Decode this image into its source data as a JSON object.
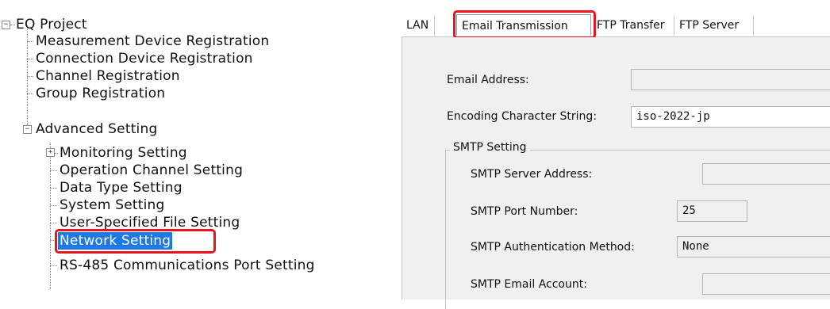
{
  "tree": {
    "root": "EQ Project",
    "items": [
      "Measurement Device Registration",
      "Connection Device Registration",
      "Channel Registration",
      "Group Registration"
    ],
    "advanced": {
      "label": "Advanced Setting",
      "children": [
        "Monitoring Setting",
        "Operation Channel Setting",
        "Data Type Setting",
        "System Setting",
        "User-Specified File Setting",
        "Network Setting",
        "RS-485 Communications Port Setting"
      ],
      "selected": "Network Setting"
    }
  },
  "tabs": [
    {
      "label": "LAN",
      "active": false
    },
    {
      "label": "Email Transmission",
      "active": true
    },
    {
      "label": "FTP Transfer",
      "active": false
    },
    {
      "label": "FTP Server",
      "active": false
    }
  ],
  "email": {
    "address_label": "Email Address:",
    "address_value": "",
    "encoding_label": "Encoding Character String:",
    "encoding_value": "iso-2022-jp"
  },
  "smtp": {
    "group_label": "SMTP Setting",
    "server_label": "SMTP Server Address:",
    "server_value": "",
    "port_label": "SMTP Port Number:",
    "port_value": "25",
    "auth_label": "SMTP Authentication Method:",
    "auth_value": "None",
    "account_label": "SMTP Email Account:",
    "account_value": ""
  },
  "colors": {
    "highlight": "#e8141e",
    "selection": "#1e78e6"
  }
}
